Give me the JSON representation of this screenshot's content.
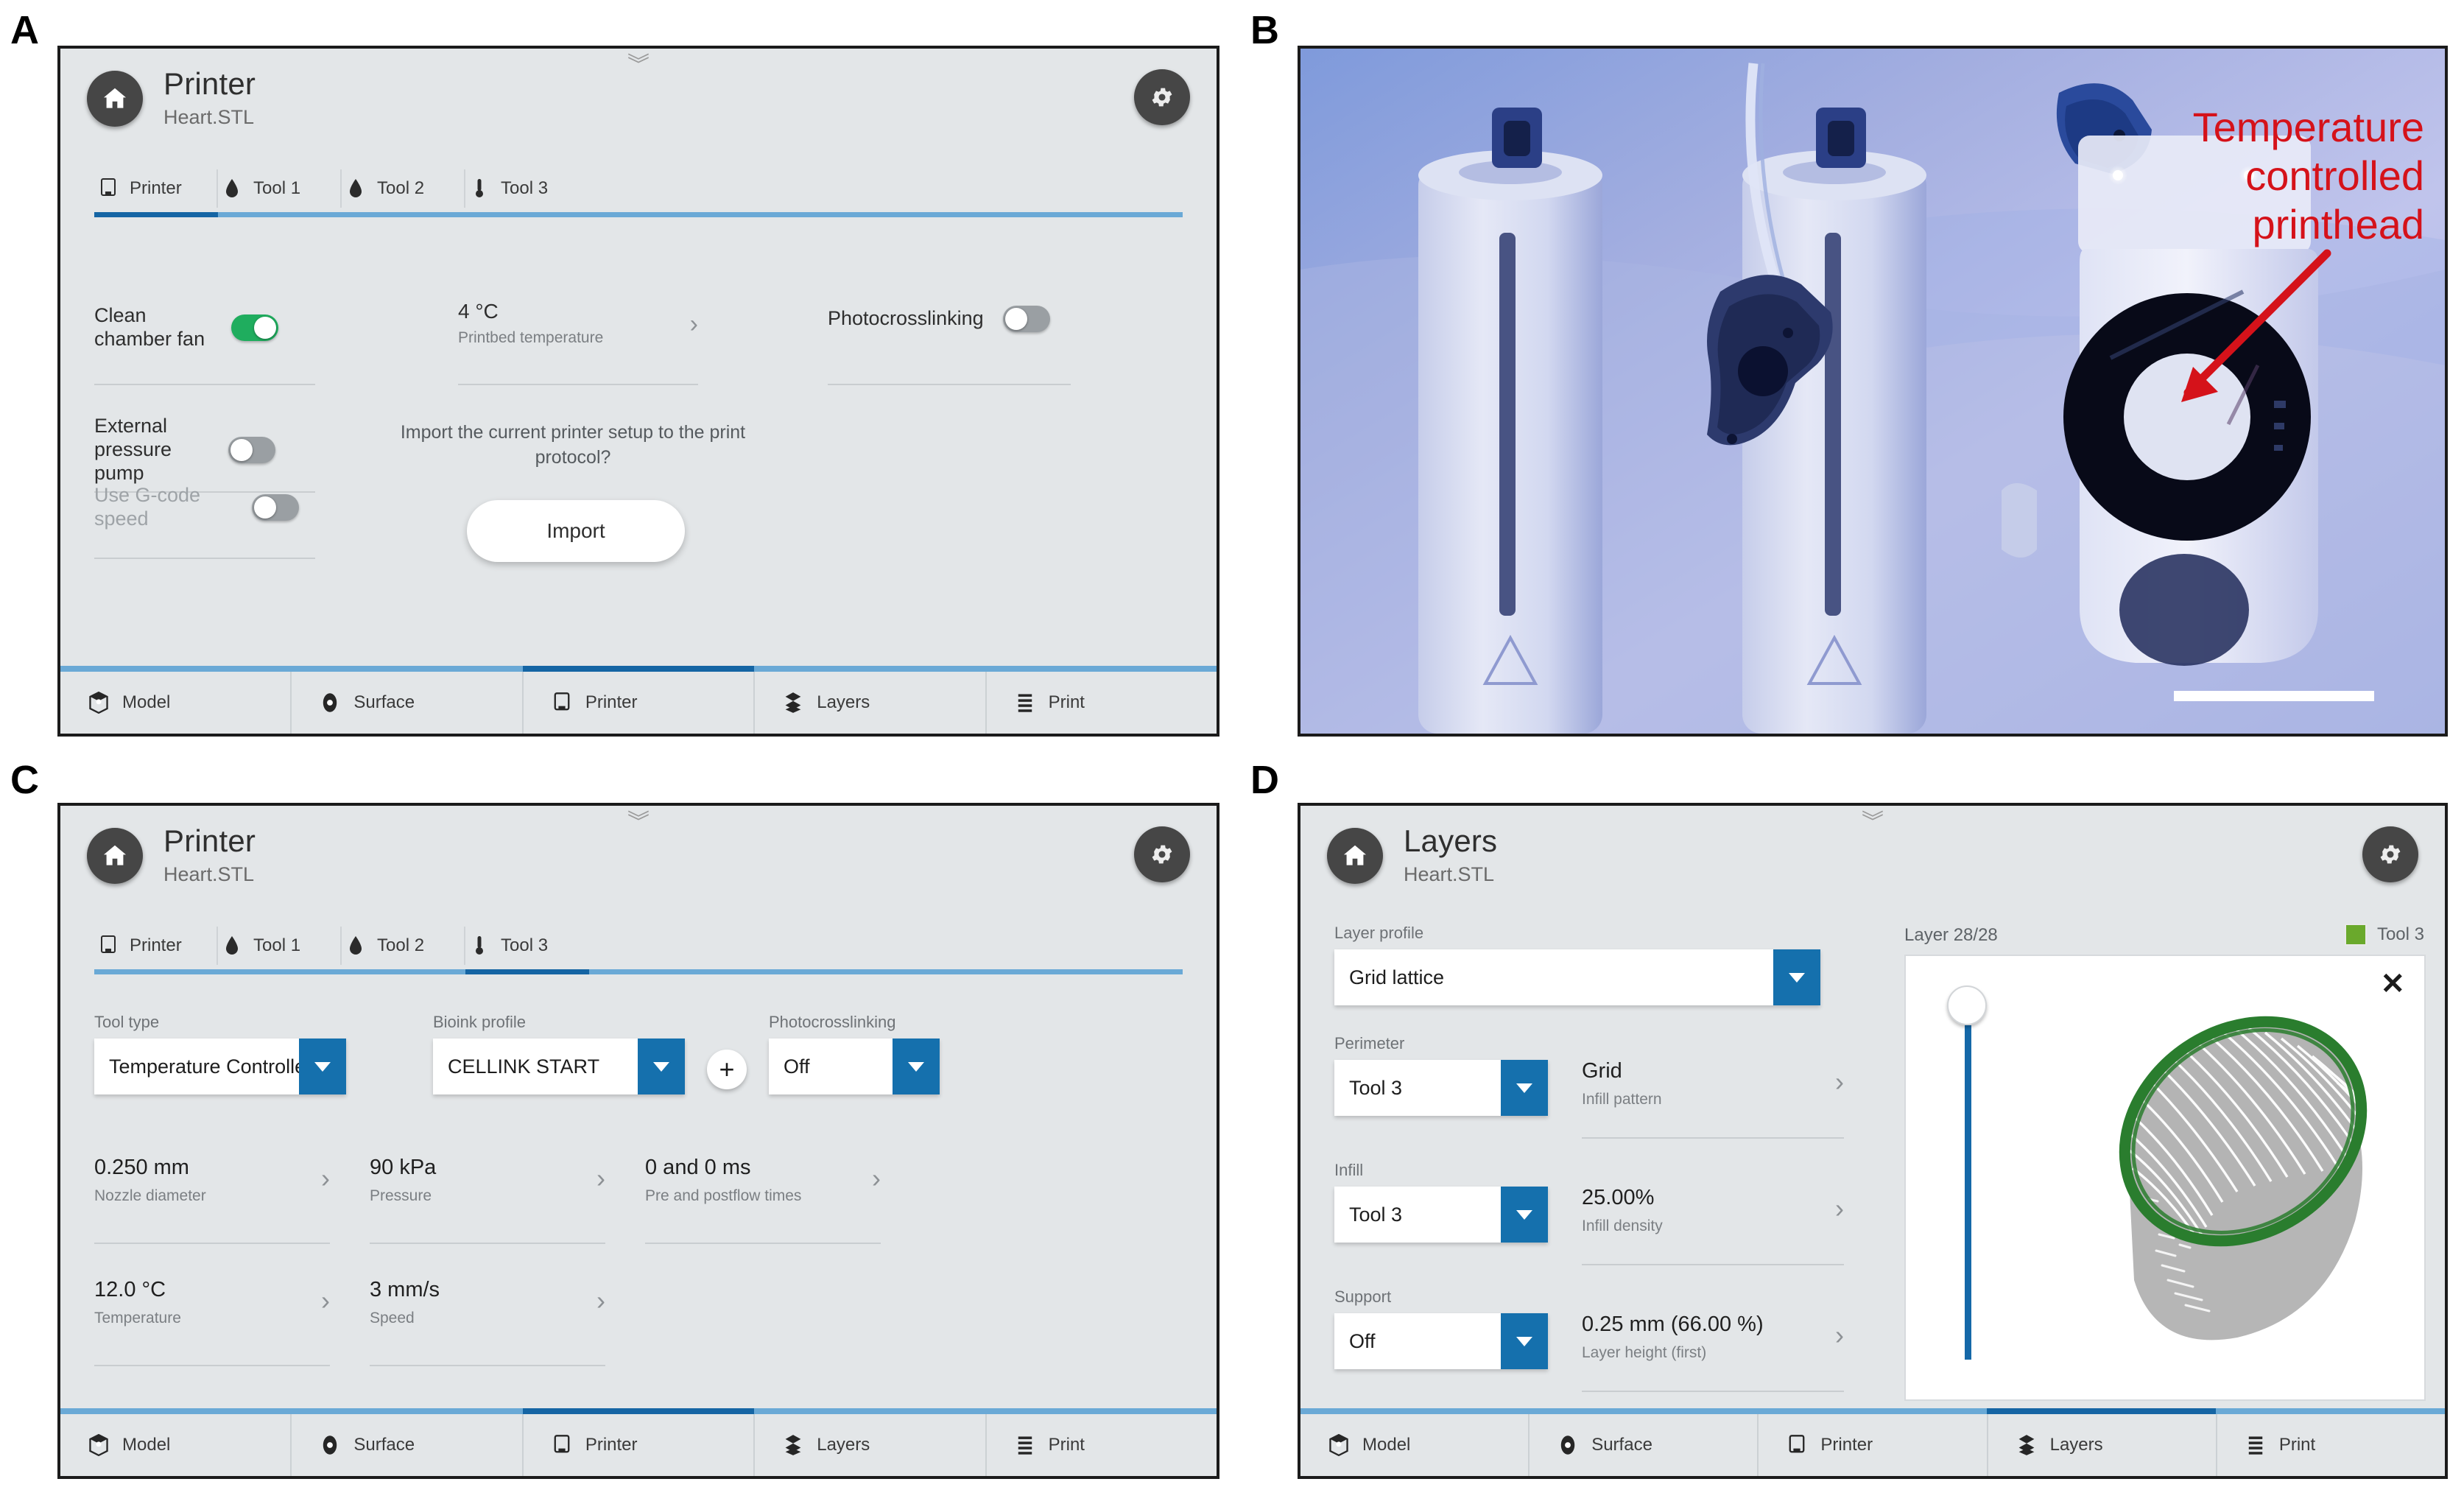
{
  "panels": {
    "a": "A",
    "b": "B",
    "c": "C",
    "d": "D"
  },
  "panel_a": {
    "header": {
      "title": "Printer",
      "subtitle": "Heart.STL"
    },
    "tool_tabs": [
      {
        "label": "Printer",
        "icon": "printer-icon",
        "active": true
      },
      {
        "label": "Tool 1",
        "icon": "droplet-icon",
        "active": false
      },
      {
        "label": "Tool 2",
        "icon": "droplet-icon",
        "active": false
      },
      {
        "label": "Tool 3",
        "icon": "thermometer-icon",
        "active": false
      }
    ],
    "settings": {
      "clean_chamber_fan": {
        "label": "Clean chamber fan",
        "state": "on"
      },
      "external_pressure_pump": {
        "label": "External pressure pump",
        "state": "off"
      },
      "use_gcode_speed": {
        "label": "Use G-code speed",
        "state": "off",
        "disabled": true
      },
      "printbed_temperature": {
        "value": "4 °C",
        "caption": "Printbed temperature"
      },
      "photocrosslinking": {
        "label": "Photocrosslinking",
        "state": "off"
      },
      "import_question": "Import the current printer setup to the print protocol?",
      "import_button": "Import"
    },
    "nav": [
      {
        "label": "Model",
        "icon": "model-icon",
        "active": false
      },
      {
        "label": "Surface",
        "icon": "surface-icon",
        "active": false
      },
      {
        "label": "Printer",
        "icon": "printer-icon",
        "active": true
      },
      {
        "label": "Layers",
        "icon": "layers-icon",
        "active": false
      },
      {
        "label": "Print",
        "icon": "print-icon",
        "active": false
      }
    ]
  },
  "panel_b": {
    "annotation_line1": "Temperature",
    "annotation_line2": "controlled",
    "annotation_line3": "printhead",
    "annotation_color": "#d5121a",
    "scale_bar": ""
  },
  "panel_c": {
    "header": {
      "title": "Printer",
      "subtitle": "Heart.STL"
    },
    "tool_tabs": [
      {
        "label": "Printer",
        "icon": "printer-icon",
        "active": false
      },
      {
        "label": "Tool 1",
        "icon": "droplet-icon",
        "active": false
      },
      {
        "label": "Tool 2",
        "icon": "droplet-icon",
        "active": false
      },
      {
        "label": "Tool 3",
        "icon": "thermometer-icon",
        "active": true
      }
    ],
    "dropdowns": [
      {
        "label": "Tool type",
        "value": "Temperature Controlled"
      },
      {
        "label": "Bioink profile",
        "value": "CELLINK START"
      },
      {
        "label": "Photocrosslinking",
        "value": "Off"
      }
    ],
    "add_button": "+",
    "stats": [
      {
        "value": "0.250 mm",
        "caption": "Nozzle diameter"
      },
      {
        "value": "90 kPa",
        "caption": "Pressure"
      },
      {
        "value": "0 and 0 ms",
        "caption": "Pre and postflow times"
      },
      {
        "value": "12.0 °C",
        "caption": "Temperature"
      },
      {
        "value": "3 mm/s",
        "caption": "Speed"
      }
    ],
    "nav": [
      {
        "label": "Model",
        "icon": "model-icon",
        "active": false
      },
      {
        "label": "Surface",
        "icon": "surface-icon",
        "active": false
      },
      {
        "label": "Printer",
        "icon": "printer-icon",
        "active": true
      },
      {
        "label": "Layers",
        "icon": "layers-icon",
        "active": false
      },
      {
        "label": "Print",
        "icon": "print-icon",
        "active": false
      }
    ]
  },
  "panel_d": {
    "header": {
      "title": "Layers",
      "subtitle": "Heart.STL"
    },
    "layer_profile": {
      "label": "Layer profile",
      "value": "Grid lattice"
    },
    "rows": [
      {
        "label": "Perimeter",
        "dropdown_value": "Tool 3",
        "stat_value": "Grid",
        "stat_caption": "Infill pattern"
      },
      {
        "label": "Infill",
        "dropdown_value": "Tool 3",
        "stat_value": "25.00%",
        "stat_caption": "Infill density"
      },
      {
        "label": "Support",
        "dropdown_value": "Off",
        "stat_value": "0.25 mm (66.00 %)",
        "stat_caption": "Layer height (first)"
      }
    ],
    "preview": {
      "layer_label": "Layer 28/28",
      "legend_label": "Tool 3",
      "legend_color": "#6aa92c",
      "close_label": "✕"
    },
    "nav": [
      {
        "label": "Model",
        "icon": "model-icon",
        "active": false
      },
      {
        "label": "Surface",
        "icon": "surface-icon",
        "active": false
      },
      {
        "label": "Printer",
        "icon": "printer-icon",
        "active": false
      },
      {
        "label": "Layers",
        "icon": "layers-icon",
        "active": true
      },
      {
        "label": "Print",
        "icon": "print-icon",
        "active": false
      }
    ]
  }
}
